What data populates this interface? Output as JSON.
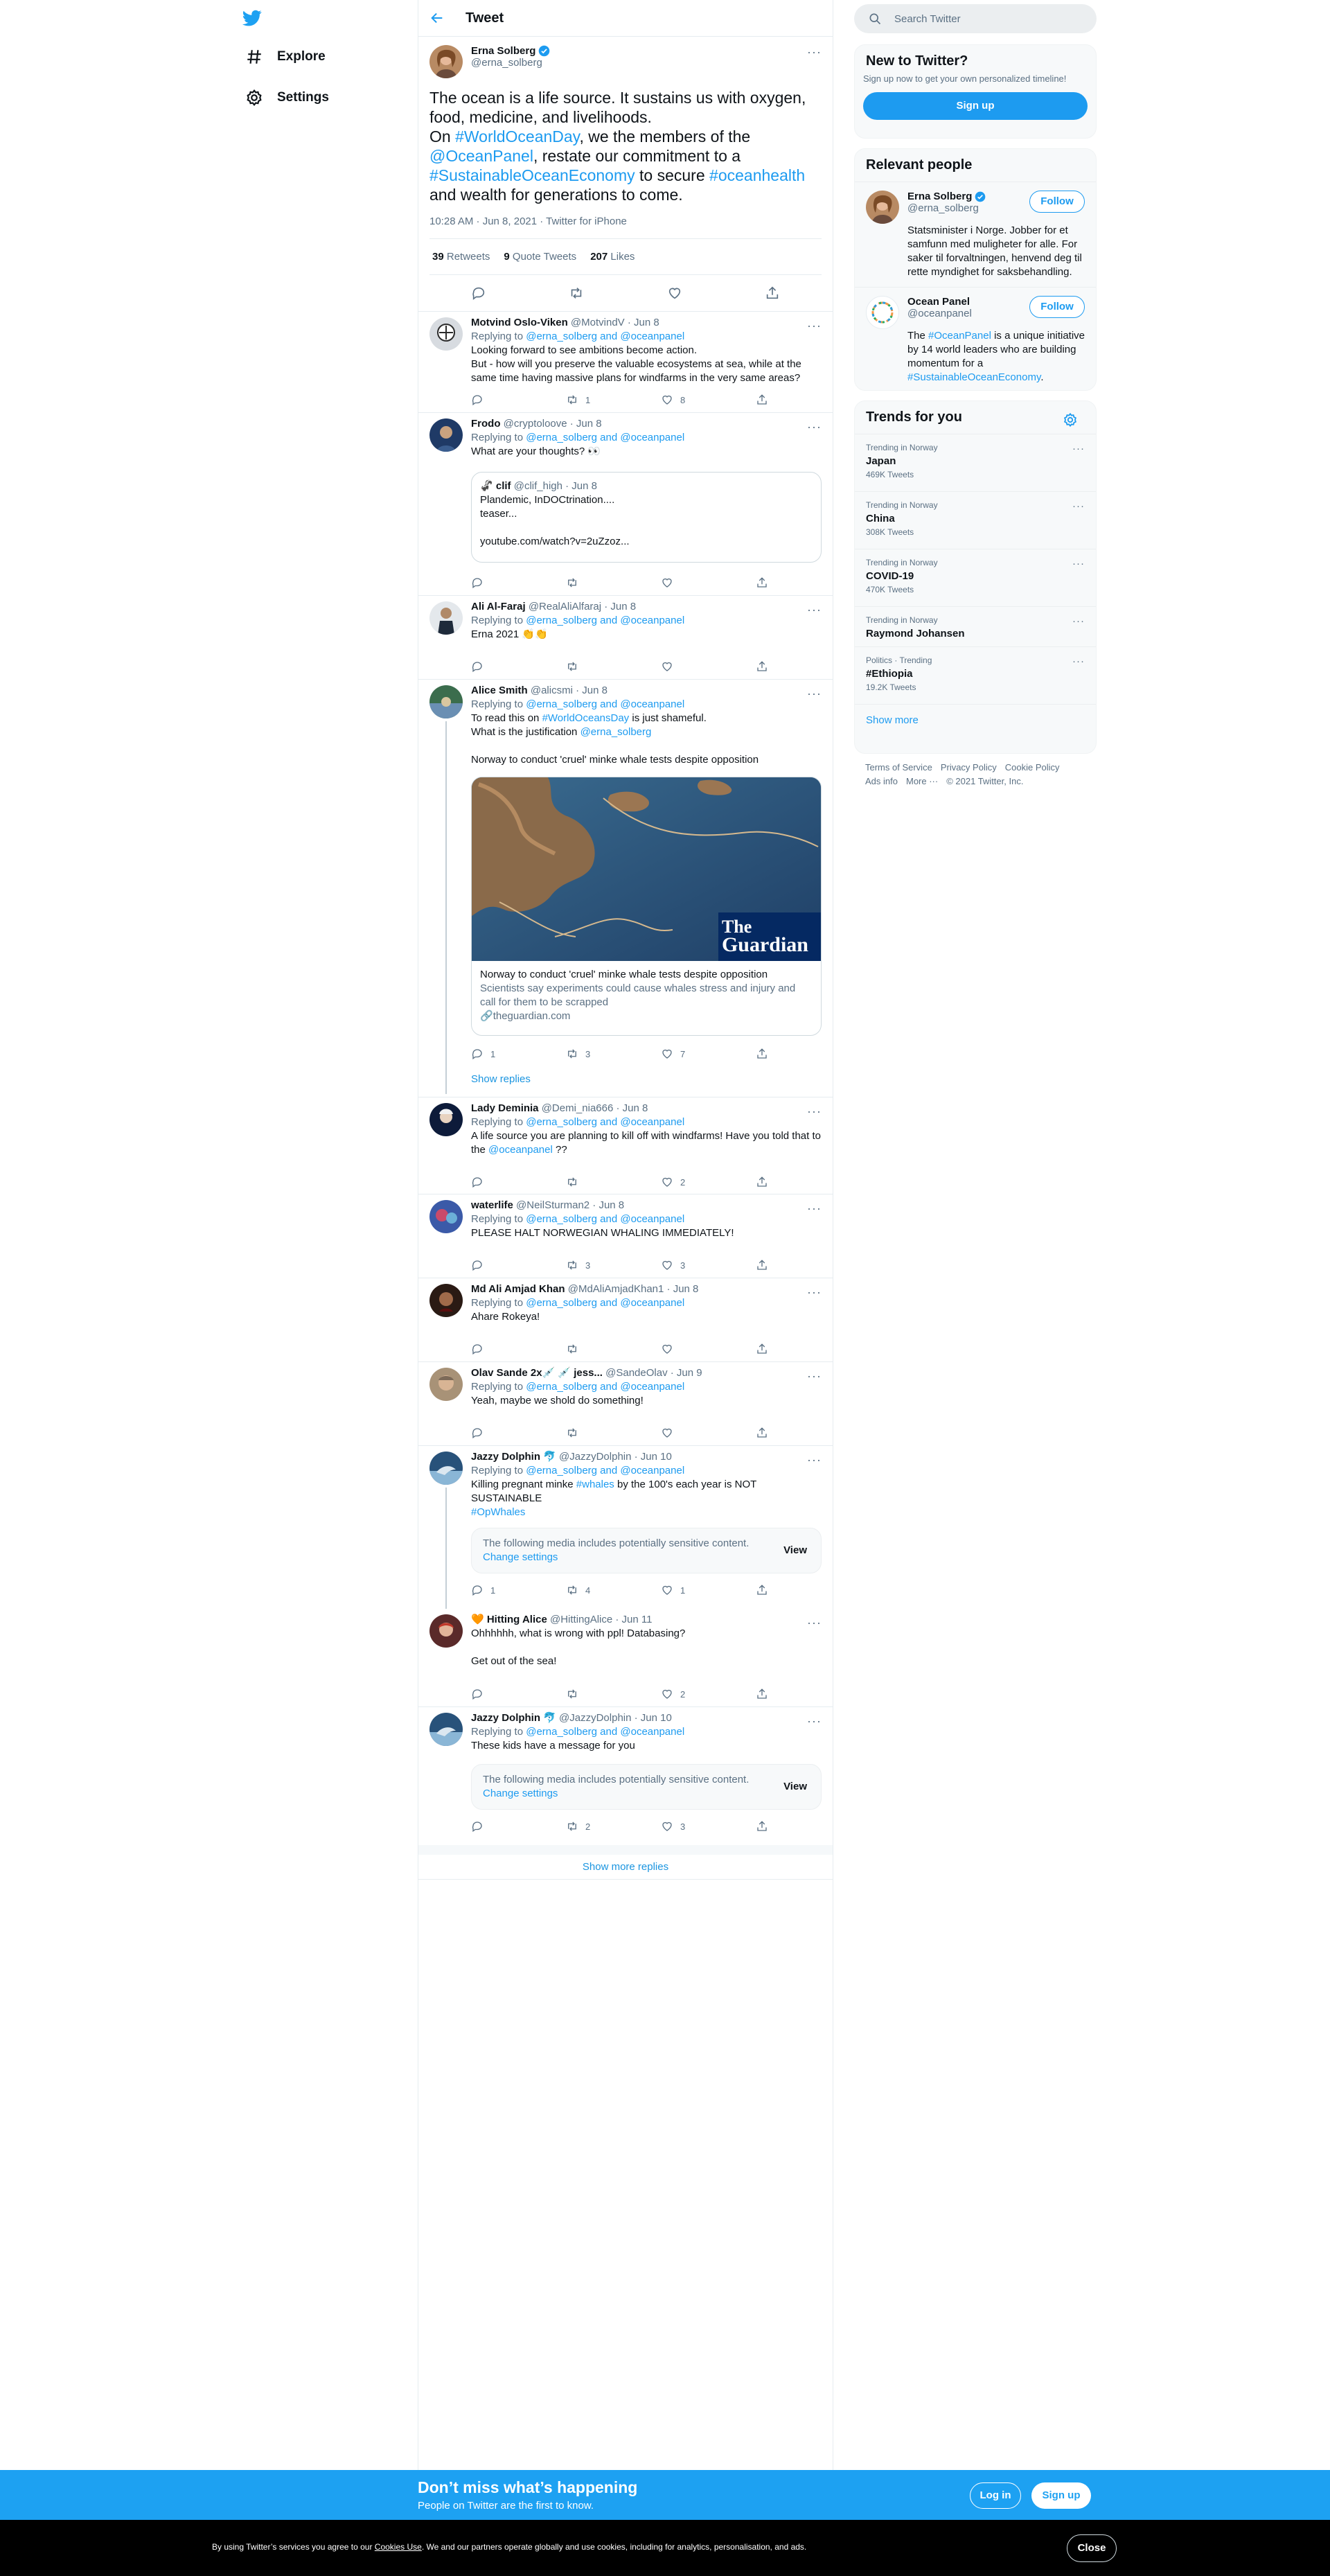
{
  "nav": {
    "explore": "Explore",
    "settings": "Settings"
  },
  "header": {
    "title": "Tweet"
  },
  "main_tweet": {
    "name": "Erna Solberg",
    "handle": "@erna_solberg",
    "text_1": "The ocean is a life source. It sustains us with oxygen, food, medicine, and livelihoods.",
    "text_2a": "On ",
    "tag_world": "#WorldOceanDay",
    "text_2b": ", we the members of the ",
    "mention_panel": "@OceanPanel",
    "text_2c": ", restate our commitment to a ",
    "tag_sustainable": "#SustainableOceanEconomy",
    "text_2d": " to secure ",
    "tag_health": "#oceanhealth",
    "text_2e": " and wealth for generations to come.",
    "meta": "10:28 AM · Jun 8, 2021 · Twitter for iPhone",
    "retweets_count": "39",
    "retweets_label": "Retweets",
    "quotes_count": "9",
    "quotes_label": "Quote Tweets",
    "likes_count": "207",
    "likes_label": "Likes"
  },
  "replies": [
    {
      "name": "Motvind Oslo-Viken",
      "meta": "@MotvindV · Jun 8",
      "replying": "Replying to",
      "to": "@erna_solberg and @oceanpanel",
      "line1": "Looking forward to see ambitions become action.",
      "line2": "But - how will you preserve the valuable ecosystems at sea, while at the same time having massive plans for windfarms in the very same areas?",
      "rt": "1",
      "likes": "8"
    },
    {
      "name": "Frodo",
      "meta": "@cryptoloove · Jun 8",
      "replying": "Replying to",
      "to": "@erna_solberg and @oceanpanel",
      "line1": "What are your thoughts? 👀",
      "quote_name": "clif",
      "quote_emoji": "🦨",
      "quote_meta": "@clif_high · Jun 8",
      "quote_l1": "Plandemic, InDOCtrination....",
      "quote_l2": "teaser...",
      "quote_l3": "youtube.com/watch?v=2uZzoz..."
    },
    {
      "name": "Ali Al-Faraj",
      "meta": "@RealAliAlfaraj · Jun 8",
      "replying": "Replying to",
      "to": "@erna_solberg and @oceanpanel",
      "line1": "Erna 2021 👏👏"
    },
    {
      "name": "Alice Smith",
      "meta": "@alicsmi · Jun 8",
      "replying": "Replying to",
      "to": "@erna_solberg and @oceanpanel",
      "line1a": "To read this on ",
      "line1_tag": "#WorldOceansDay",
      "line1b": " is just shameful.",
      "line2a": "What is the justification ",
      "line2_mention": "@erna_solberg",
      "line3": "Norway to conduct 'cruel' minke whale tests despite opposition",
      "card_title": "Norway to conduct 'cruel' minke whale tests despite opposition",
      "card_desc": "Scientists say experiments could cause whales stress and injury and call for them to be scrapped",
      "card_domain": "theguardian.com",
      "card_logo_1": "The",
      "card_logo_2": "Guardian",
      "replies_count": "1",
      "rt": "3",
      "likes": "7",
      "show_replies": "Show replies"
    },
    {
      "name": "Lady Deminia",
      "meta": "@Demi_nia666 · Jun 8",
      "replying": "Replying to",
      "to": "@erna_solberg and @oceanpanel",
      "line1": "A life source you are planning to kill off with windfarms! Have you told that to the ",
      "line1_mention": "@oceanpanel",
      "line1b": " ??",
      "likes": "2"
    },
    {
      "name": "waterlife",
      "meta": "@NeilSturman2 · Jun 8",
      "replying": "Replying to",
      "to": "@erna_solberg and @oceanpanel",
      "line1": "PLEASE HALT NORWEGIAN WHALING IMMEDIATELY!",
      "rt": "3",
      "likes": "3"
    },
    {
      "name": "Md Ali Amjad Khan",
      "meta": "@MdAliAmjadKhan1 · Jun 8",
      "replying": "Replying to",
      "to": "@erna_solberg and @oceanpanel",
      "line1": "Ahare Rokeya!"
    },
    {
      "name": "Olav Sande 2x💉 💉 jess...",
      "meta": "@SandeOlav · Jun 9",
      "replying": "Replying to",
      "to": "@erna_solberg and @oceanpanel",
      "line1": "Yeah, maybe we shold do something!"
    },
    {
      "name": "Jazzy Dolphin 🐬",
      "meta": "@JazzyDolphin · Jun 10",
      "replying": "Replying to",
      "to": "@erna_solberg and @oceanpanel",
      "line1a": "Killing pregnant minke ",
      "line1_tag": "#whales",
      "line1b": " by the 100's each year is NOT SUSTAINABLE",
      "line2_tag": "#OpWhales",
      "sens_text": "The following media includes potentially sensitive content.",
      "sens_link": "Change settings",
      "sens_view": "View",
      "replies_count": "1",
      "rt": "4",
      "likes": "1"
    },
    {
      "name": "🧡 Hitting Alice",
      "meta": "@HittingAlice · Jun 11",
      "line1": "Ohhhhhh, what is wrong with ppl!  Databasing?",
      "line2": "Get out of the sea!",
      "likes": "2"
    },
    {
      "name": "Jazzy Dolphin 🐬",
      "meta": "@JazzyDolphin · Jun 10",
      "replying": "Replying to",
      "to": "@erna_solberg and @oceanpanel",
      "line1": "These kids have a message for you",
      "sens_text": "The following media includes potentially sensitive content.",
      "sens_link": "Change settings",
      "sens_view": "View",
      "rt": "2",
      "likes": "3"
    }
  ],
  "show_more_replies": "Show more replies",
  "right": {
    "search_placeholder": "Search Twitter",
    "new_title": "New to Twitter?",
    "new_sub": "Sign up now to get your own personalized timeline!",
    "signup": "Sign up",
    "relevant_title": "Relevant people",
    "people": [
      {
        "name": "Erna Solberg",
        "handle": "@erna_solberg",
        "follow": "Follow",
        "bio": "Statsminister i Norge. Jobber for et samfunn med muligheter for alle. For saker til forvaltningen, henvend deg til rette myndighet for saksbehandling."
      },
      {
        "name": "Ocean Panel",
        "handle": "@oceanpanel",
        "follow": "Follow",
        "bio_a": "The ",
        "bio_tag": "#OceanPanel",
        "bio_b": " is a unique initiative by 14 world leaders who are building momentum for a ",
        "bio_tag2": "#SustainableOceanEconomy",
        "bio_c": "."
      }
    ],
    "trends_title": "Trends for you",
    "trends": [
      {
        "kicker": "Trending in Norway",
        "topic": "Japan",
        "count": "469K Tweets"
      },
      {
        "kicker": "Trending in Norway",
        "topic": "China",
        "count": "308K Tweets"
      },
      {
        "kicker": "Trending in Norway",
        "topic": "COVID-19",
        "count": "470K Tweets"
      },
      {
        "kicker": "Trending in Norway",
        "topic": "Raymond Johansen",
        "count": ""
      },
      {
        "kicker": "Politics · Trending",
        "topic": "#Ethiopia",
        "count": "19.2K Tweets"
      }
    ],
    "show_more": "Show more",
    "footer": {
      "terms": "Terms of Service",
      "privacy": "Privacy Policy",
      "cookie": "Cookie Policy",
      "ads": "Ads info",
      "more": "More ···",
      "copy": "© 2021 Twitter, Inc."
    }
  },
  "banner": {
    "title": "Don’t miss what’s happening",
    "sub": "People on Twitter are the first to know.",
    "login": "Log in",
    "signup": "Sign up"
  },
  "cookie": {
    "text_a": "By using Twitter’s services you agree to our ",
    "link": "Cookies Use",
    "text_b": ". We and our partners operate globally and use cookies, including for analytics, personalisation, and ads.",
    "close": "Close"
  },
  "colors": {
    "accent": "#1d9bf0",
    "banner": "#1da1f2"
  }
}
